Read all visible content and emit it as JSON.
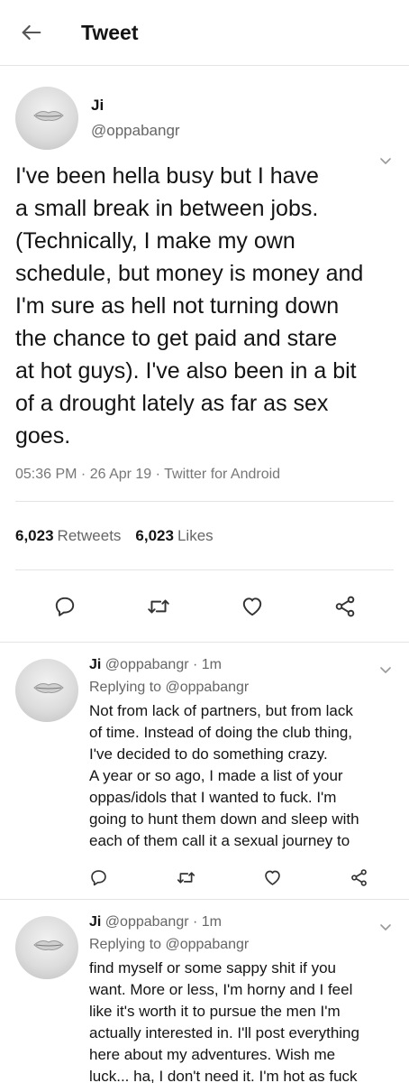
{
  "header": {
    "title": "Tweet"
  },
  "main_tweet": {
    "name": "Ji",
    "handle": "@oppabangr",
    "text": "I've been hella busy but I have\na small break in between jobs.\n(Technically, I make my own\nschedule, but money is money and\nI'm sure as hell not turning down\nthe chance to get paid and stare\nat hot guys). I've also been in a bit\nof a drought lately as far as sex\ngoes.",
    "timestamp": "05:36 PM · 26 Apr 19 · Twitter for Android",
    "retweets_count": "6,023",
    "retweets_label": "Retweets",
    "likes_count": "6,023",
    "likes_label": "Likes"
  },
  "replies": [
    {
      "name": "Ji",
      "handle_time": "@oppabangr · 1m",
      "replying_to": "Replying to @oppabangr",
      "text": "Not from lack of partners, but from lack\nof time. Instead of doing the club thing,\nI've decided to do something crazy.\nA year or so ago, I made a list of your\noppas/idols that I wanted to fuck. I'm\ngoing to hunt them down and sleep with\neach of them call it a sexual journey to"
    },
    {
      "name": "Ji",
      "handle_time": "@oppabangr · 1m",
      "replying_to": "Replying to @oppabangr",
      "text": "find myself or some sappy shit if you\nwant. More or less, I'm horny and I feel\nlike it's worth it to pursue the men I'm\nactually interested in. I'll post everything\nhere about my adventures. Wish me\nluck... ha, I don't need it. I'm hot as fuck"
    }
  ],
  "icons": {
    "back": "arrow-left-icon",
    "more": "chevron-down-icon",
    "reply": "comment-icon",
    "retweet": "retweet-icon",
    "like": "heart-icon",
    "share": "share-icon"
  }
}
